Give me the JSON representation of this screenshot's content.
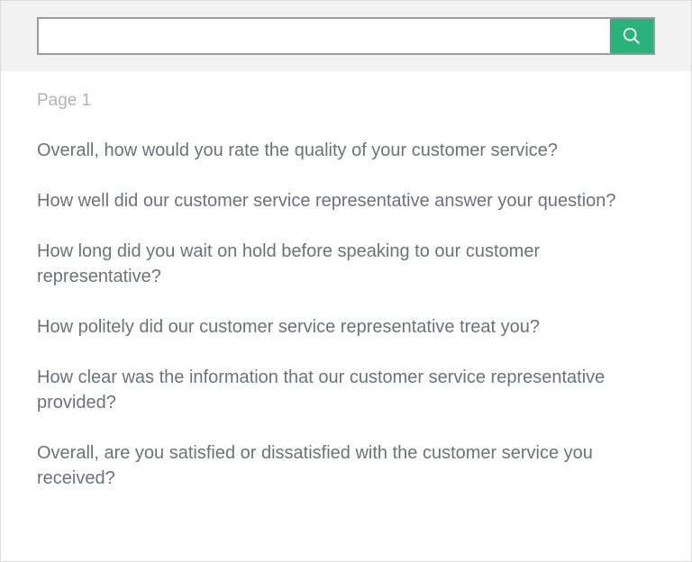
{
  "search": {
    "value": "",
    "placeholder": ""
  },
  "page_label": "Page 1",
  "questions": [
    "Overall, how would you rate the quality of your customer service?",
    "How well did our customer service representative answer your question?",
    "How long did you wait on hold before speaking to our customer representative?",
    "How politely did our customer service representative treat you?",
    "How clear was the information that our customer service representative provided?",
    "Overall, are you satisfied or dissatisfied with the customer service you received?"
  ]
}
